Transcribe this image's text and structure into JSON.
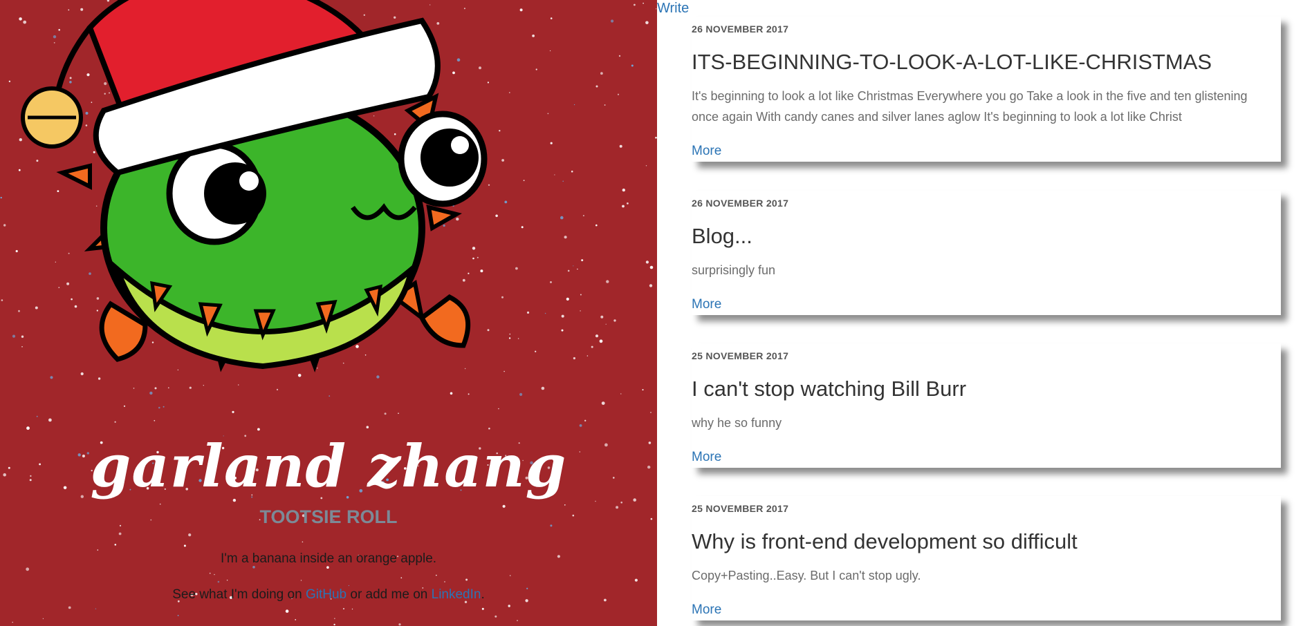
{
  "profile": {
    "name": "garland zhang",
    "subtitle": "TOOTSIE ROLL",
    "bio": "I'm a banana inside an orange apple.",
    "links_prefix": "See what I'm doing on ",
    "github_label": "GitHub",
    "links_middle": " or add me on ",
    "linkedin_label": "LinkedIn",
    "links_suffix": "."
  },
  "nav": {
    "write_label": "Write"
  },
  "posts": [
    {
      "date": "26 NOVEMBER 2017",
      "title": "ITS-BEGINNING-TO-LOOK-A-LOT-LIKE-CHRISTMAS",
      "excerpt": "It's beginning to look a lot like Christmas Everywhere you go Take a look in the five and ten glistening once again With candy canes and silver lanes aglow It's beginning to look a lot like Christ",
      "more_label": "More"
    },
    {
      "date": "26 NOVEMBER 2017",
      "title": "Blog...",
      "excerpt": "surprisingly fun",
      "more_label": "More"
    },
    {
      "date": "25 NOVEMBER 2017",
      "title": "I can't stop watching Bill Burr",
      "excerpt": "why he so funny",
      "more_label": "More"
    },
    {
      "date": "25 NOVEMBER 2017",
      "title": "Why is front-end development so difficult",
      "excerpt": "Copy+Pasting..Easy. But I can't stop ugly.",
      "more_label": "More"
    }
  ],
  "colors": {
    "hero_bg": "#a1262a",
    "link": "#2b74b5",
    "mascot_green": "#3cb52a"
  },
  "icons": [
    "santa-hat-mascot-illustration"
  ]
}
